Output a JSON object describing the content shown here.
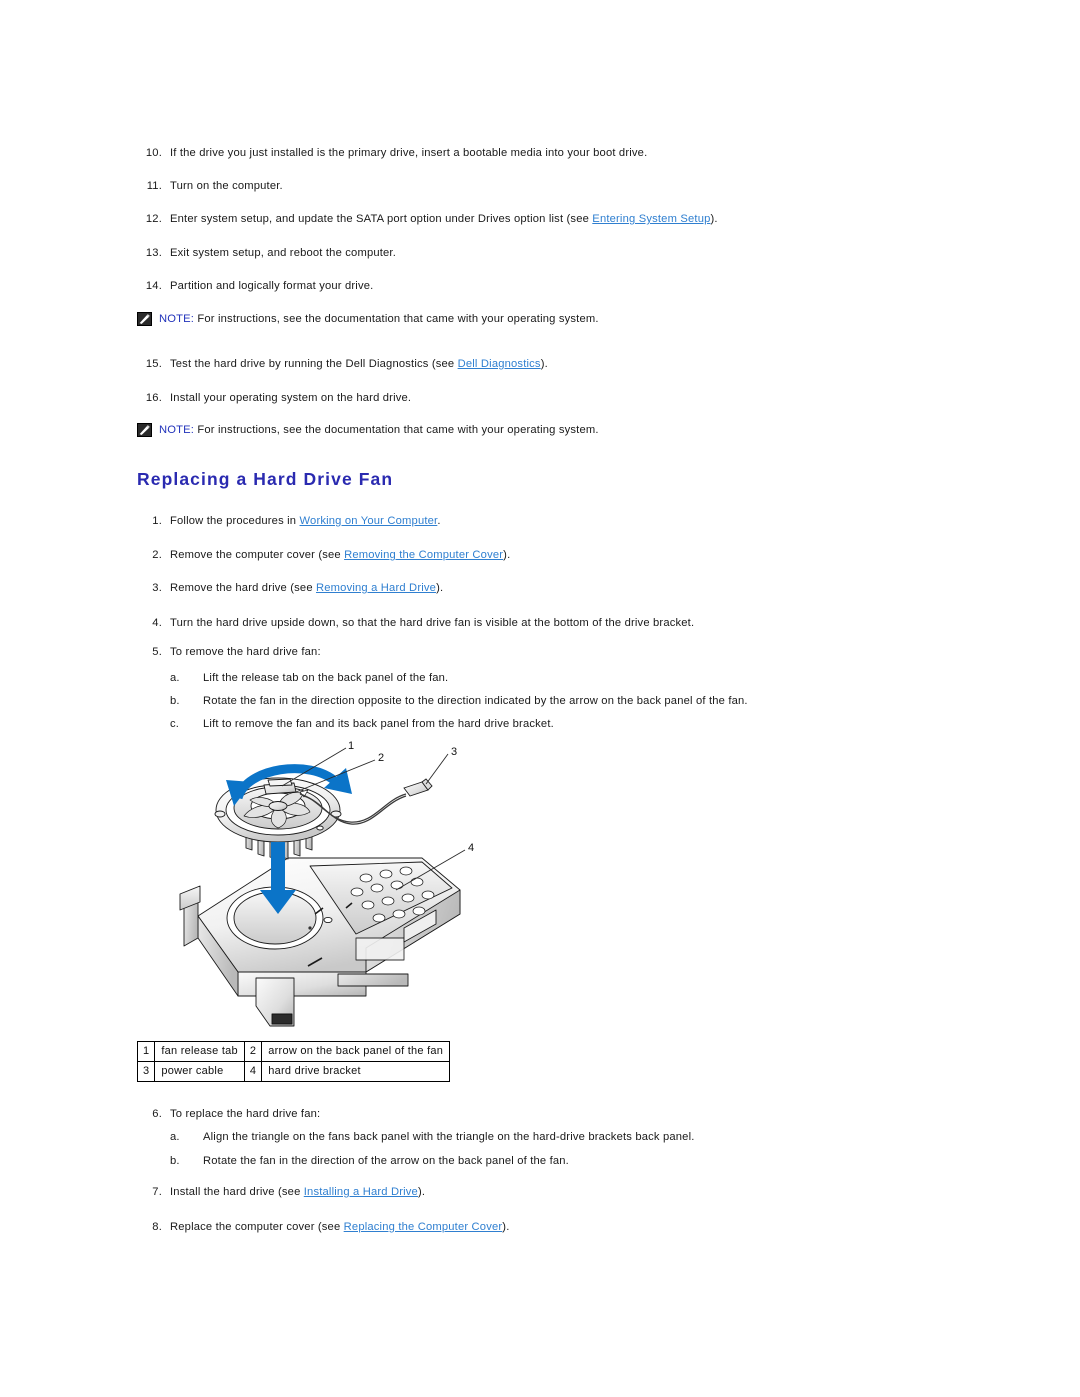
{
  "document": {
    "section_heading": "Replacing a Hard Drive Fan",
    "accent_heading_color": "#2a2ab0",
    "link_color": "#2f7fd0",
    "note_label_color": "#2233bb",
    "arrow_color": "#0b74c8"
  },
  "top_steps": [
    {
      "num": "10.",
      "text": "If the drive you just installed is the primary drive, insert a bootable media into your boot drive."
    },
    {
      "num": "11.",
      "text": "Turn on the computer."
    },
    {
      "num": "12.",
      "pre": "Enter system setup, and update the SATA port option under Drives option list (see ",
      "link": "Entering System Setup",
      "post": ")."
    },
    {
      "num": "13.",
      "text": "Exit system setup, and reboot the computer."
    },
    {
      "num": "14.",
      "text": "Partition and logically format your drive."
    }
  ],
  "note_one": {
    "label": "NOTE:",
    "text": " For instructions, see the documentation that came with your operating system.",
    "icon": "note-pencil-icon"
  },
  "mid_steps": [
    {
      "num": "15.",
      "pre": "Test the hard drive by running the Dell Diagnostics (see ",
      "link": "Dell Diagnostics",
      "post": ")."
    },
    {
      "num": "16.",
      "text": "Install your operating system on the hard drive."
    }
  ],
  "note_two": {
    "label": "NOTE:",
    "text": " For instructions, see the documentation that came with your operating system.",
    "icon": "note-pencil-icon"
  },
  "procedure_steps": [
    {
      "num": "1.",
      "pre": "Follow the procedures in ",
      "link": "Working on Your Computer",
      "post": "."
    },
    {
      "num": "2.",
      "pre": "Remove the computer cover (see ",
      "link": "Removing the Computer Cover",
      "post": ")."
    },
    {
      "num": "3.",
      "pre": "Remove the hard drive (see ",
      "link": "Removing a Hard Drive",
      "post": ")."
    },
    {
      "num": "4.",
      "text": "Turn the hard drive upside down, so that the hard drive fan is visible at the bottom of the drive bracket."
    },
    {
      "num": "5.",
      "text": "To remove the hard drive fan:"
    }
  ],
  "remove_substeps": [
    {
      "num": "a.",
      "text": "Lift the release tab on the back panel of the fan."
    },
    {
      "num": "b.",
      "text": "Rotate the fan in the direction opposite to the direction indicated by the arrow on the back panel of the fan."
    },
    {
      "num": "c.",
      "text": "Lift to remove the fan and its back panel from the hard drive bracket."
    }
  ],
  "figure": {
    "name": "hard-drive-fan-exploded-diagram",
    "callouts": [
      "1",
      "2",
      "3",
      "4"
    ]
  },
  "legend": {
    "rows": [
      [
        {
          "idx": "1",
          "label": "fan release tab"
        },
        {
          "idx": "2",
          "label": "arrow on the back panel of the fan"
        }
      ],
      [
        {
          "idx": "3",
          "label": "power cable"
        },
        {
          "idx": "4",
          "label": "hard drive bracket"
        }
      ]
    ]
  },
  "replace_steps": [
    {
      "num": "6.",
      "text": "To replace the hard drive fan:"
    }
  ],
  "replace_substeps": [
    {
      "num": "a.",
      "text": "Align the triangle on the fans back panel with the triangle on the hard-drive brackets back panel."
    },
    {
      "num": "b.",
      "text": "Rotate the fan in the direction of the arrow on the back panel of the fan."
    }
  ],
  "final_steps": [
    {
      "num": "7.",
      "pre": "Install the hard drive (see ",
      "link": "Installing a Hard Drive",
      "post": ")."
    },
    {
      "num": "8.",
      "pre": "Replace the computer cover (see ",
      "link": "Replacing the Computer Cover",
      "post": ")."
    }
  ]
}
